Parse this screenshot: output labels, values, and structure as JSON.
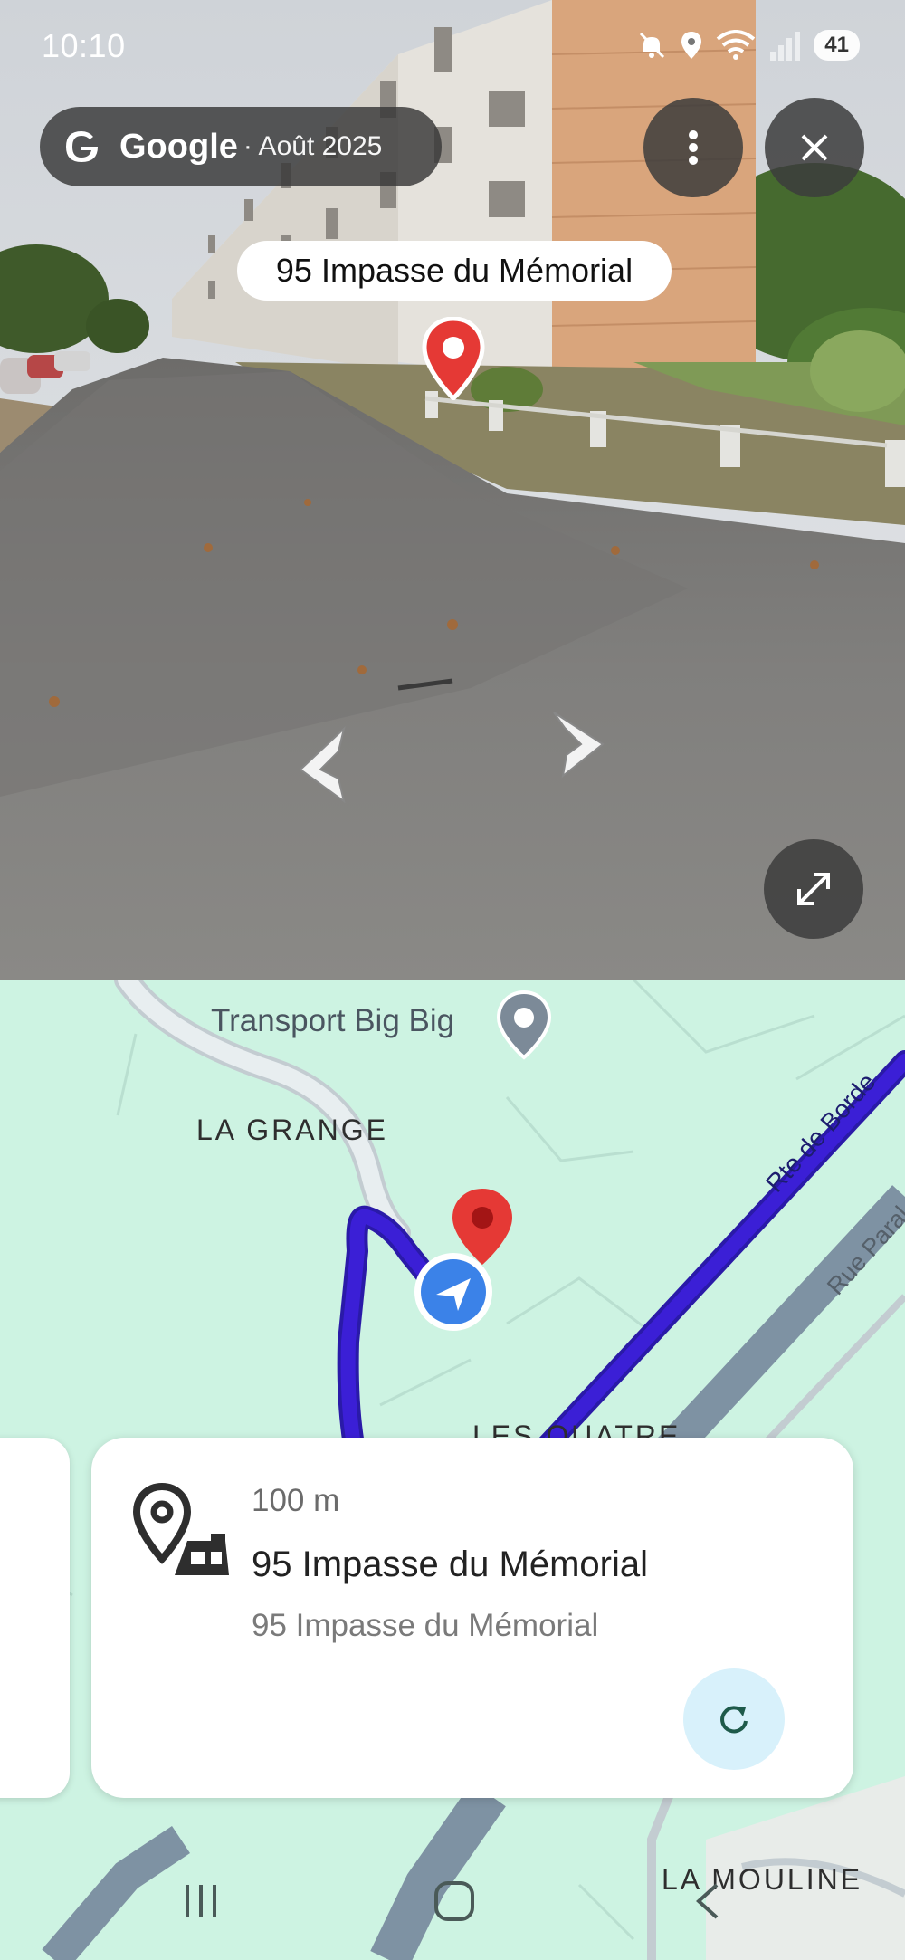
{
  "status_bar": {
    "time": "10:10",
    "battery": "41"
  },
  "streetview": {
    "provider": "Google",
    "date": "· Août 2025",
    "address_label": "95 Impasse du Mémorial"
  },
  "map": {
    "poi_name": "Transport Big Big",
    "area_grange": "LA GRANGE",
    "area_quatre": "LES QUATRE",
    "area_mouline": "LA MOULINE",
    "road_borde": "Rte de Borde",
    "road_rue": "Rue Paral"
  },
  "card": {
    "distance": "100 m",
    "title": "95 Impasse du Mémorial",
    "subtitle": "95 Impasse du Mémorial"
  },
  "colors": {
    "route": "#3b1fd6",
    "pin": "#e53935",
    "map_bg": "#cdf3e2",
    "refresh_bg": "#d8f1fb"
  }
}
